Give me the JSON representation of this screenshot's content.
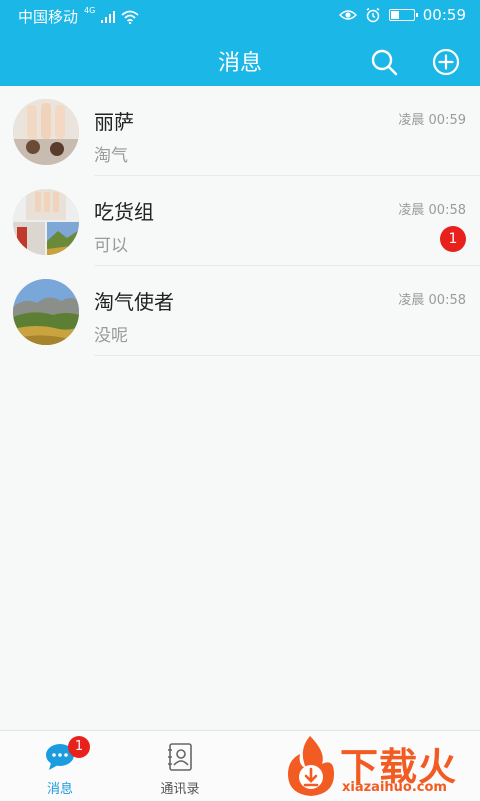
{
  "status_bar": {
    "carrier": "中国移动",
    "network": "4G",
    "time": "00:59",
    "battery_level": 0.35
  },
  "header": {
    "title": "消息",
    "icons": [
      "search-icon",
      "add-circle-icon"
    ]
  },
  "conversations": [
    {
      "name": "丽萨",
      "preview": "淘气",
      "time": "凌晨 00:59",
      "unread": null,
      "avatar": "photo-avatar-feet"
    },
    {
      "name": "吃货组",
      "preview": "可以",
      "time": "凌晨 00:58",
      "unread": "1",
      "avatar": "group-avatar-collage"
    },
    {
      "name": "淘气使者",
      "preview": "没呢",
      "time": "凌晨 00:58",
      "unread": null,
      "avatar": "photo-avatar-landscape"
    }
  ],
  "bottom_nav": {
    "tabs": [
      {
        "label": "消息",
        "badge": "1",
        "icon": "chat-bubble-icon",
        "active": true
      },
      {
        "label": "通讯录",
        "badge": null,
        "icon": "contacts-book-icon",
        "active": false
      }
    ]
  },
  "watermark": {
    "title": "下载火",
    "url": "xiazaihuo.com"
  },
  "colors": {
    "accent": "#1bb7e6",
    "badge": "#e8211c",
    "active_tab": "#1b9be0",
    "watermark": "#f25b22"
  }
}
